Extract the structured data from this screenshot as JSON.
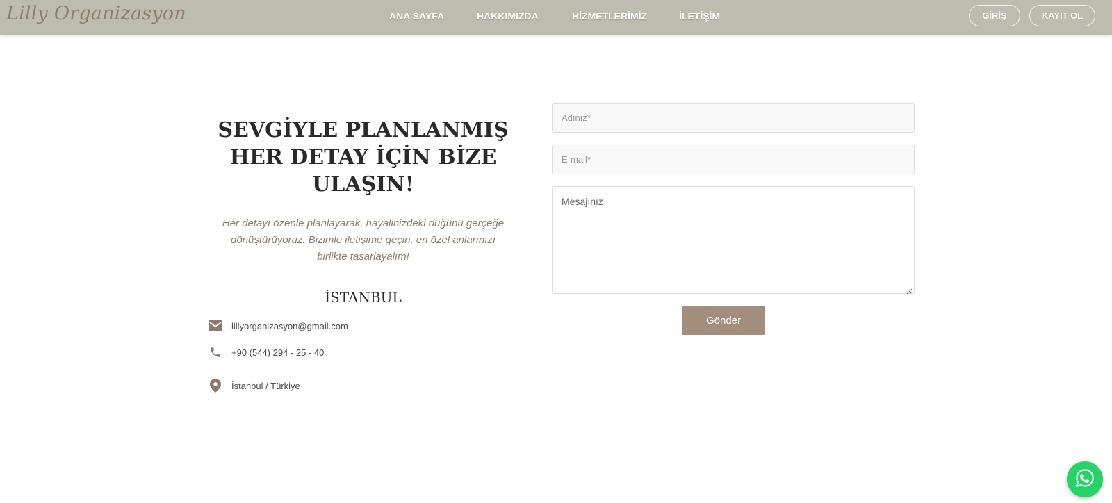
{
  "brand": {
    "name": "Lilly Organizasyon"
  },
  "nav": {
    "links": [
      "ANA SAYFA",
      "HAKKIMIZDA",
      "HİZMETLERİMİZ",
      "İLETİŞİM"
    ],
    "login_label": "GİRİŞ",
    "register_label": "KAYIT OL"
  },
  "contact": {
    "headline_lines": [
      "SEVGİYLE PLANLANMIŞ",
      "HER DETAY İÇİN BİZE",
      "ULAŞIN!"
    ],
    "lead_lines": [
      "Her detayı özenle planlayarak, hayalinizdeki düğünü gerçeğe",
      "dönüştürüyoruz. Bizimle iletişime geçin, en özel anlarınızı",
      "birlikte tasarlayalım!"
    ],
    "city": "İSTANBUL",
    "email": "lillyorganizasyon@gmail.com",
    "phone": "+90 (544) 294 - 25 - 40",
    "address": "İstanbul / Türkiye",
    "icons": {
      "email": "mail-icon",
      "phone": "phone-icon",
      "address": "location-pin-icon"
    }
  },
  "form": {
    "name_placeholder": "Adınız*",
    "email_placeholder": "E-mail*",
    "message_placeholder": "Mesajınız",
    "submit_label": "Gönder"
  },
  "floating": {
    "whatsapp_icon": "whatsapp-icon"
  },
  "colors": {
    "navbar_bg": "#bcbdae",
    "brand_text": "#8e7c6c",
    "accent": "#a38e7e",
    "icon_color": "#8b7b6c",
    "whatsapp_green": "#25d366"
  }
}
